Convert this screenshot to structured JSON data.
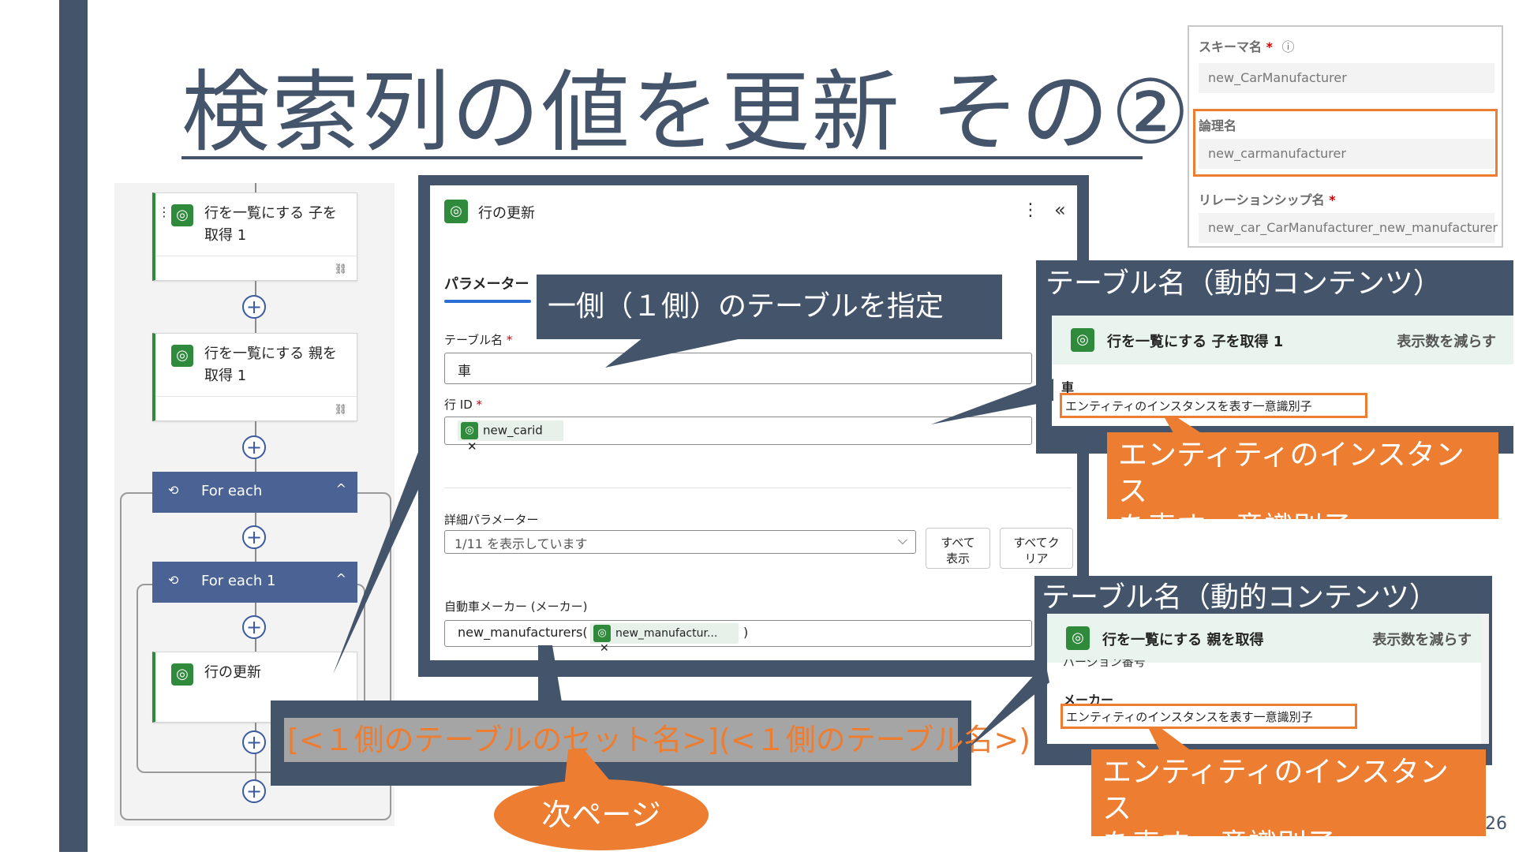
{
  "slide": {
    "title": "検索列の値を更新 その②",
    "page_number": "26"
  },
  "flow": {
    "card1": {
      "label_line1": "行を一覧にする 子を",
      "label_line2": "取得 1"
    },
    "card2": {
      "label_line1": "行を一覧にする 親を",
      "label_line2": "取得 1"
    },
    "foreach": "For each",
    "foreach1": "For each 1",
    "update_card": "行の更新",
    "plus": "+",
    "link_glyph": "⛓",
    "loop_glyph": "⟲",
    "chevron_up": "^",
    "drag_glyph": "⋮"
  },
  "dialog": {
    "title": "行の更新",
    "more": "⋮",
    "collapse": "«",
    "tab_parameters": "パラメーター",
    "table_label": "テーブル名",
    "table_value": "車",
    "rowid_label": "行 ID",
    "rowid_chip": "new_carid",
    "chip_remove": "✕",
    "required_mark": "*",
    "advanced_label": "詳細パラメーター",
    "advanced_select": "1/11 を表示しています",
    "show_all_line1": "すべて",
    "show_all_line2": "表示",
    "clear_all_line1": "すべてク",
    "clear_all_line2": "リア",
    "maker_label": "自動車メーカー (メーカー)",
    "maker_prefix": "new_manufacturers(",
    "maker_chip": "new_manufactur...",
    "maker_suffix": ")",
    "select_arrow": "⌵"
  },
  "callouts": {
    "one_side": "一側（１側）のテーブルを指定",
    "formula": "[<１側のテーブルのセット名>](<１側のテーブル名>)",
    "next_page": "次ページ",
    "dyn_title": "テーブル名（動的コンテンツ）",
    "entity_id_line1": "エンティティのインスタンス",
    "entity_id_line2": "を表す一意識別子"
  },
  "schema_panel": {
    "schema_label": "スキーマ名",
    "schema_required": "*",
    "info_icon": "ⓘ",
    "schema_value": "new_CarManufacturer",
    "logical_label": "論理名",
    "logical_value": "new_carmanufacturer",
    "relation_label": "リレーションシップ名",
    "relation_required": "*",
    "relation_value": "new_car_CarManufacturer_new_manufacturer"
  },
  "dynamic_child": {
    "header": "行を一覧にする 子を取得 1",
    "reduce": "表示数を減らす",
    "item_title": "車",
    "item_desc": "エンティティのインスタンスを表す一意識別子"
  },
  "dynamic_parent": {
    "header": "行を一覧にする 親を取得",
    "reduce": "表示数を減らす",
    "cut_text": "バージョン番号",
    "item_title": "メーカー",
    "item_desc": "エンティティのインスタンスを表す一意識別子"
  },
  "colors": {
    "slate": "#44546a",
    "orange": "#ed7d31",
    "green": "#2f8a3c",
    "loop_blue": "#4b6394"
  }
}
